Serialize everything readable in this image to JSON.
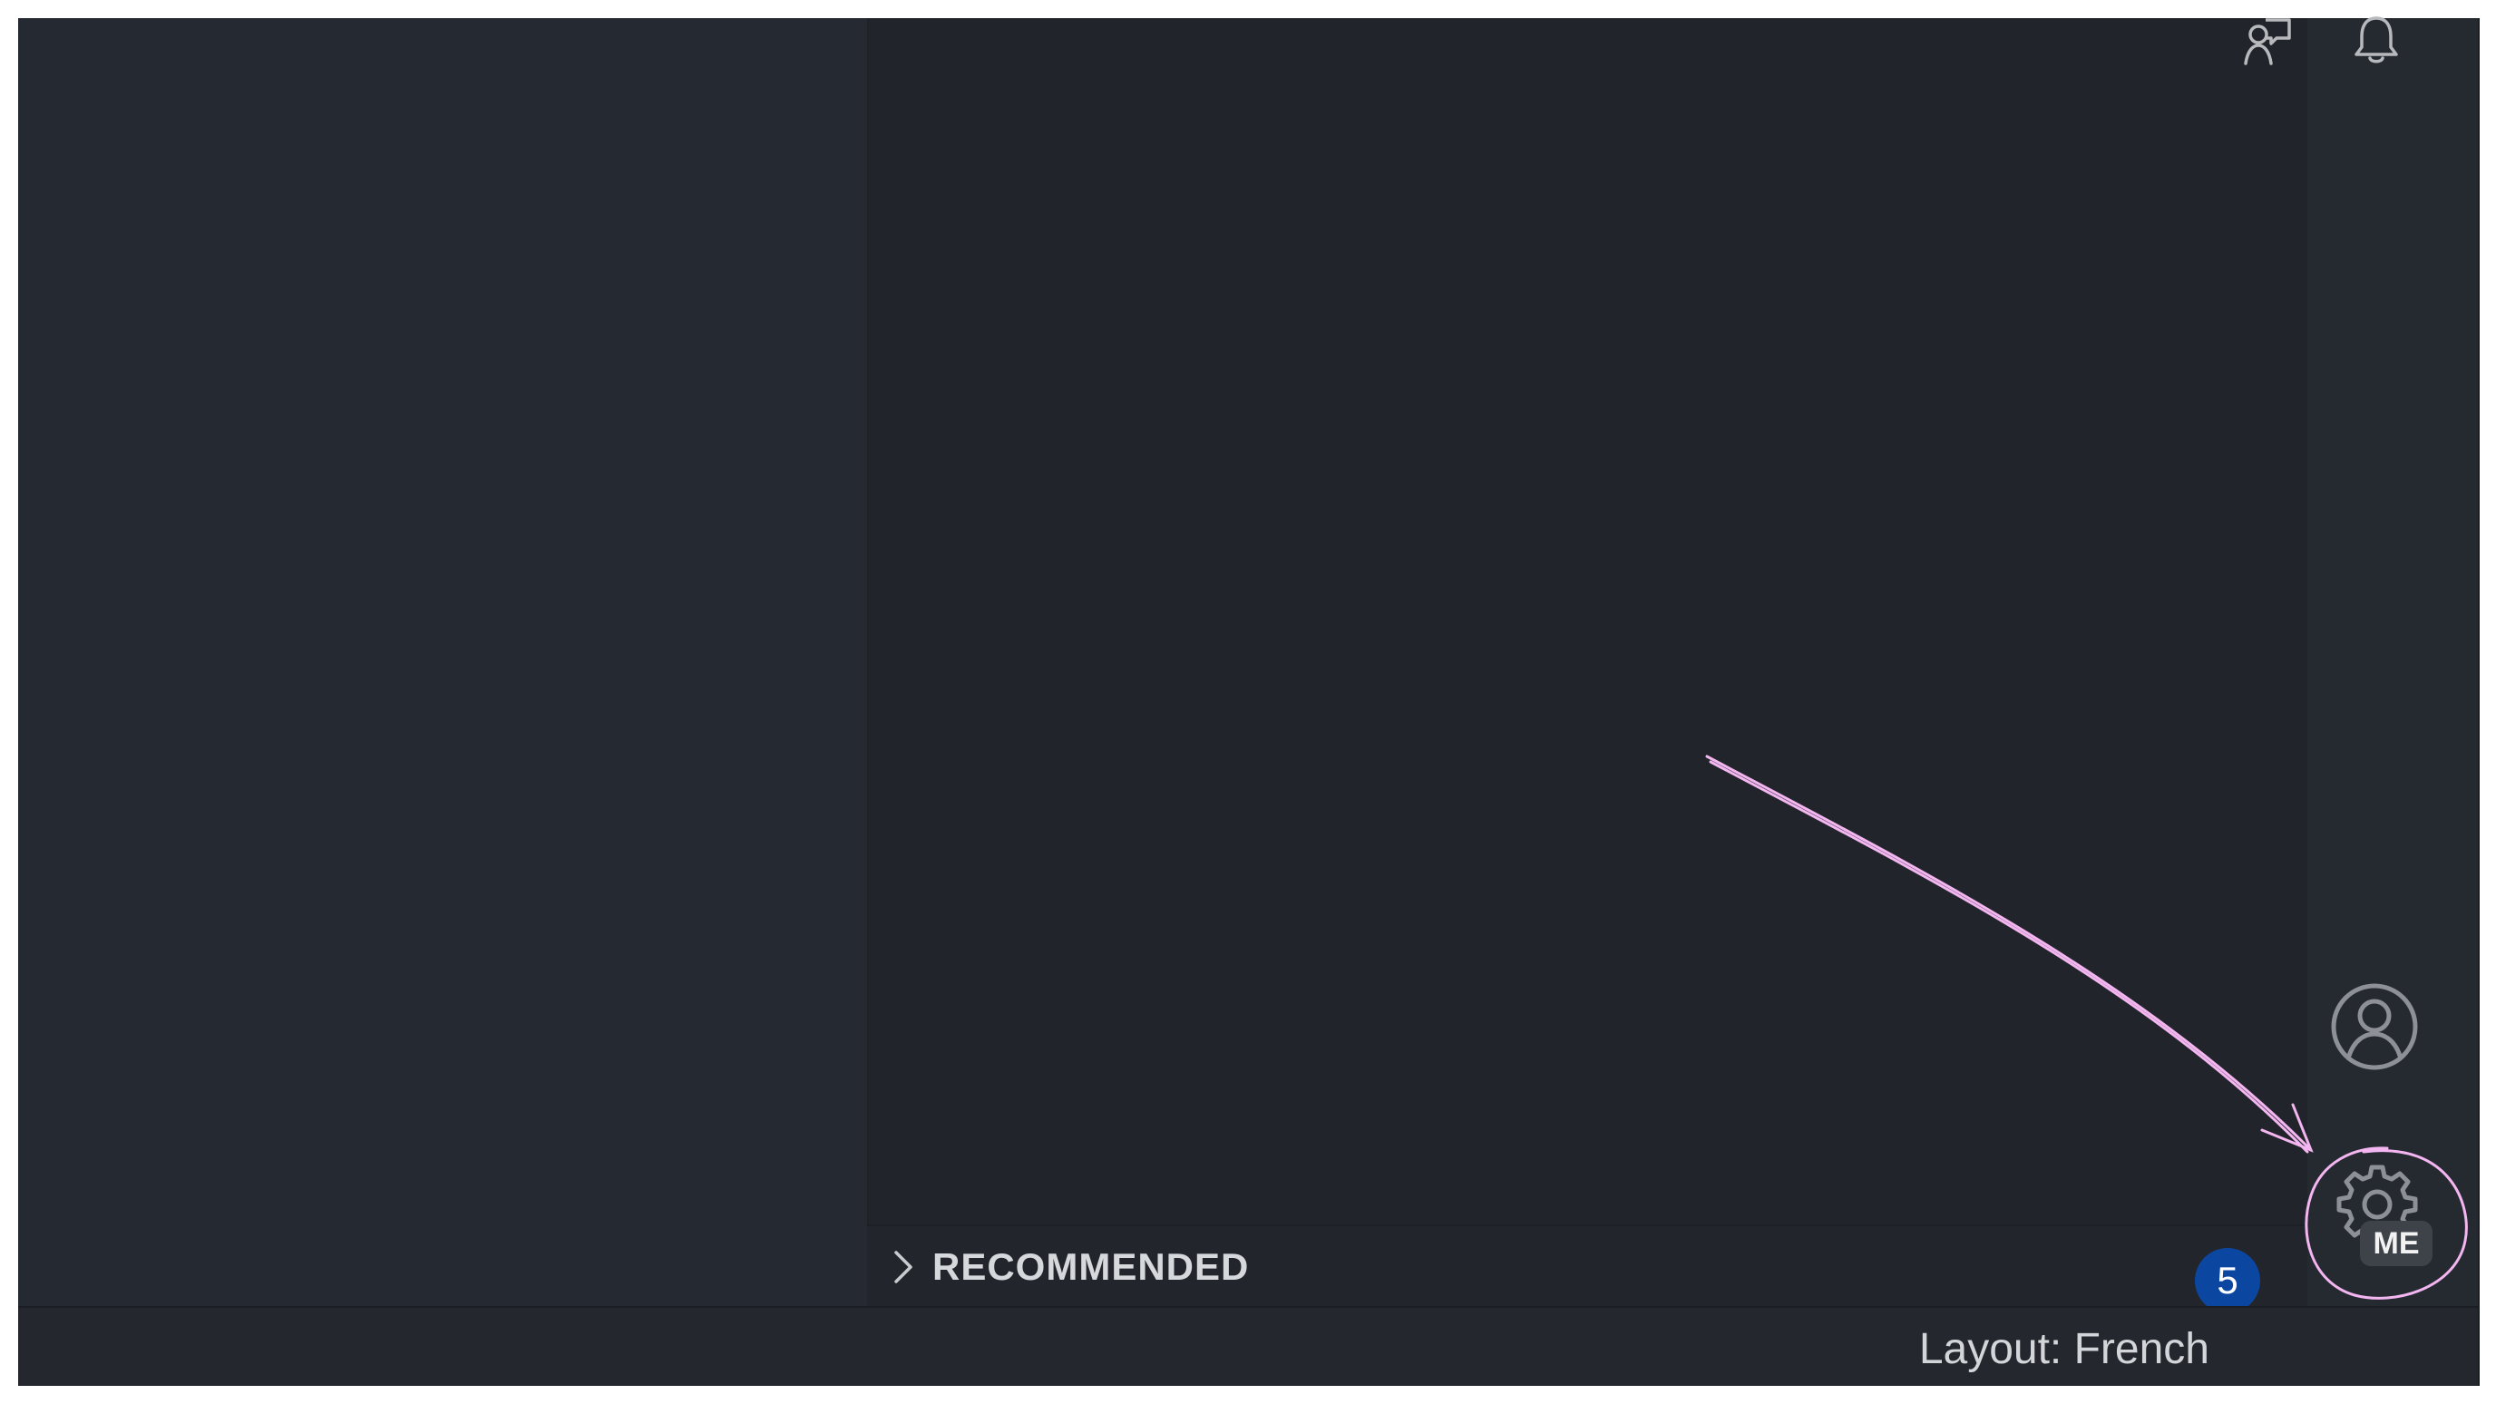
{
  "sections": {
    "recommended": {
      "label": "RECOMMENDED",
      "badge_count": "5"
    }
  },
  "activity_bar": {
    "accounts_icon": "account-icon",
    "manage_icon": "gear-icon",
    "manage_badge": "ME"
  },
  "status_bar": {
    "layout": "Layout: French",
    "feedback_icon": "feedback-icon",
    "notifications_icon": "bell-icon"
  },
  "colors": {
    "background": "#252a31",
    "badge": "#0b47a1",
    "annotation": "#f3b6f0"
  }
}
